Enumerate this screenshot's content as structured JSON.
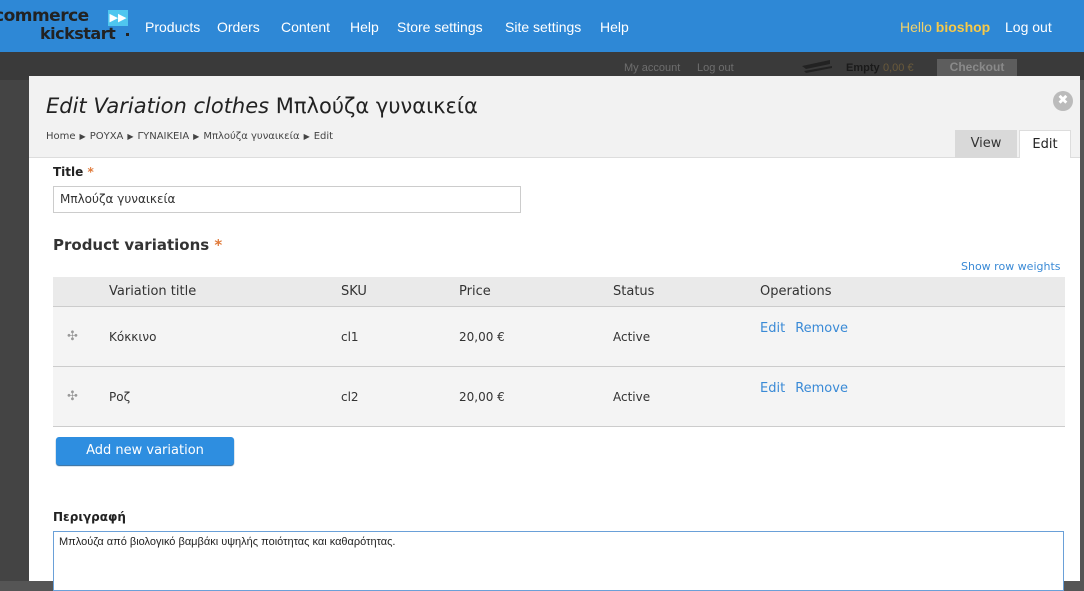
{
  "brand": {
    "line1": "commerce",
    "line2": "kickstart"
  },
  "toolbar": {
    "menu": [
      "Products",
      "Orders",
      "Content",
      "Help",
      "Store settings",
      "Site settings",
      "Help"
    ],
    "hello": "Hello",
    "user": "bioshop",
    "logout": "Log out"
  },
  "store": {
    "my_account": "My account",
    "log_out": "Log out",
    "cart_status": "Empty",
    "cart_amount": "0,00 €",
    "checkout": "Checkout"
  },
  "page": {
    "title_prefix": "Edit Variation clothes",
    "title_name": "Μπλούζα γυναικεία",
    "breadcrumb": [
      "Home",
      "ΡΟΥΧΑ",
      "ΓΥΝΑΙΚΕΙΑ",
      "Μπλούζα γυναικεία",
      "Edit"
    ],
    "tabs": {
      "view": "View",
      "edit": "Edit"
    },
    "close": "✖"
  },
  "form": {
    "title_label": "Title",
    "title_value": "Μπλούζα γυναικεία",
    "variations_heading": "Product variations",
    "show_row_weights": "Show row weights",
    "columns": [
      "Variation title",
      "SKU",
      "Price",
      "Status",
      "Operations"
    ],
    "rows": [
      {
        "title": "Κόκκινο",
        "sku": "cl1",
        "price": "20,00 €",
        "status": "Active",
        "edit": "Edit",
        "remove": "Remove"
      },
      {
        "title": "Ροζ",
        "sku": "cl2",
        "price": "20,00 €",
        "status": "Active",
        "edit": "Edit",
        "remove": "Remove"
      }
    ],
    "add_variation": "Add new variation",
    "description_label": "Περιγραφή",
    "description_value": "Μπλούζα από βιολογικό βαμβάκι υψηλής ποιότητας και καθαρότητας."
  },
  "colors": {
    "toolbar": "#2e88d6",
    "link": "#3a8ad6",
    "button": "#2e8ee0",
    "required": "#e07a3a"
  }
}
